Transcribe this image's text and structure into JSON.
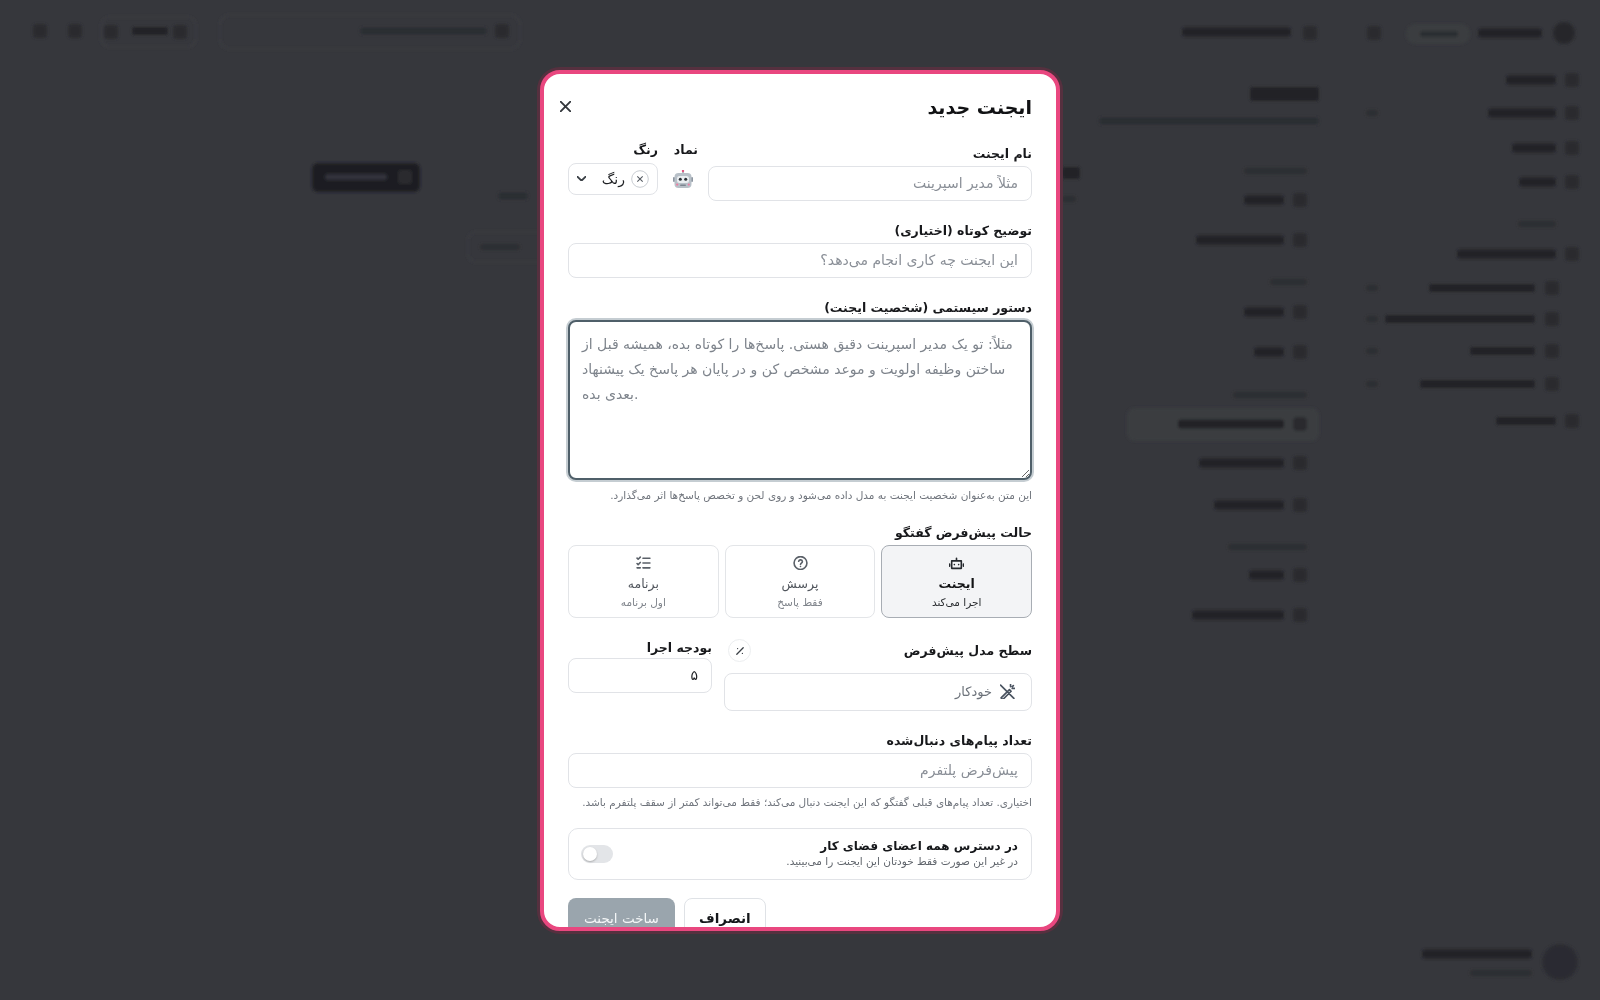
{
  "modal": {
    "title": "ایجنت جدید",
    "name_field": {
      "label": "نام ایجنت",
      "placeholder": "مثلاً مدیر اسپرینت"
    },
    "symbol": {
      "label": "نماد"
    },
    "color": {
      "label": "رنگ",
      "value": "رنگ"
    },
    "description_field": {
      "label": "توضیح کوتاه (اختیاری)",
      "placeholder": "این ایجنت چه کاری انجام می‌دهد؟"
    },
    "system_prompt": {
      "label": "دستور سیستمی (شخصیت ایجنت)",
      "placeholder": "مثلاً: تو یک مدیر اسپرینت دقیق هستی. پاسخ‌ها را کوتاه بده، همیشه قبل از ساختن وظیفه اولویت و موعد مشخص کن و در پایان هر پاسخ یک پیشنهاد بعدی بده.",
      "focused": true,
      "hint": "این متن به‌عنوان شخصیت ایجنت به مدل داده می‌شود و روی لحن و تخصص پاسخ‌ها اثر می‌گذارد."
    },
    "mode": {
      "label": "حالت پیش‌فرض گفتگو",
      "options": [
        {
          "kind": "agent",
          "title": "ایجنت",
          "subtitle": "اجرا می‌کند",
          "selected": true
        },
        {
          "kind": "ask",
          "title": "پرسش",
          "subtitle": "فقط پاسخ",
          "selected": false
        },
        {
          "kind": "plan",
          "title": "برنامه",
          "subtitle": "اول برنامه",
          "selected": false
        }
      ]
    },
    "model_level": {
      "label": "سطح مدل پیش‌فرض",
      "value": "خودکار"
    },
    "budget": {
      "label": "بودجه اجرا",
      "value": "۵"
    },
    "tracked_messages": {
      "label": "تعداد پیام‌های دنبال‌شده",
      "placeholder": "پیش‌فرض پلتفرم",
      "hint": "اختیاری. تعداد پیام‌های قبلی گفتگو که این ایجنت دنبال می‌کند؛ فقط می‌تواند کمتر از سقف پلتفرم باشد."
    },
    "workspace_access": {
      "title": "در دسترس همه اعضای فضای کار",
      "description": "در غیر این صورت فقط خودتان این ایجنت را می‌بینید.",
      "on": false
    },
    "buttons": [
      {
        "kind": "secondary",
        "label": "انصراف",
        "disabled": false
      },
      {
        "kind": "primary",
        "label": "ساخت ایجنت",
        "disabled": true
      }
    ]
  }
}
